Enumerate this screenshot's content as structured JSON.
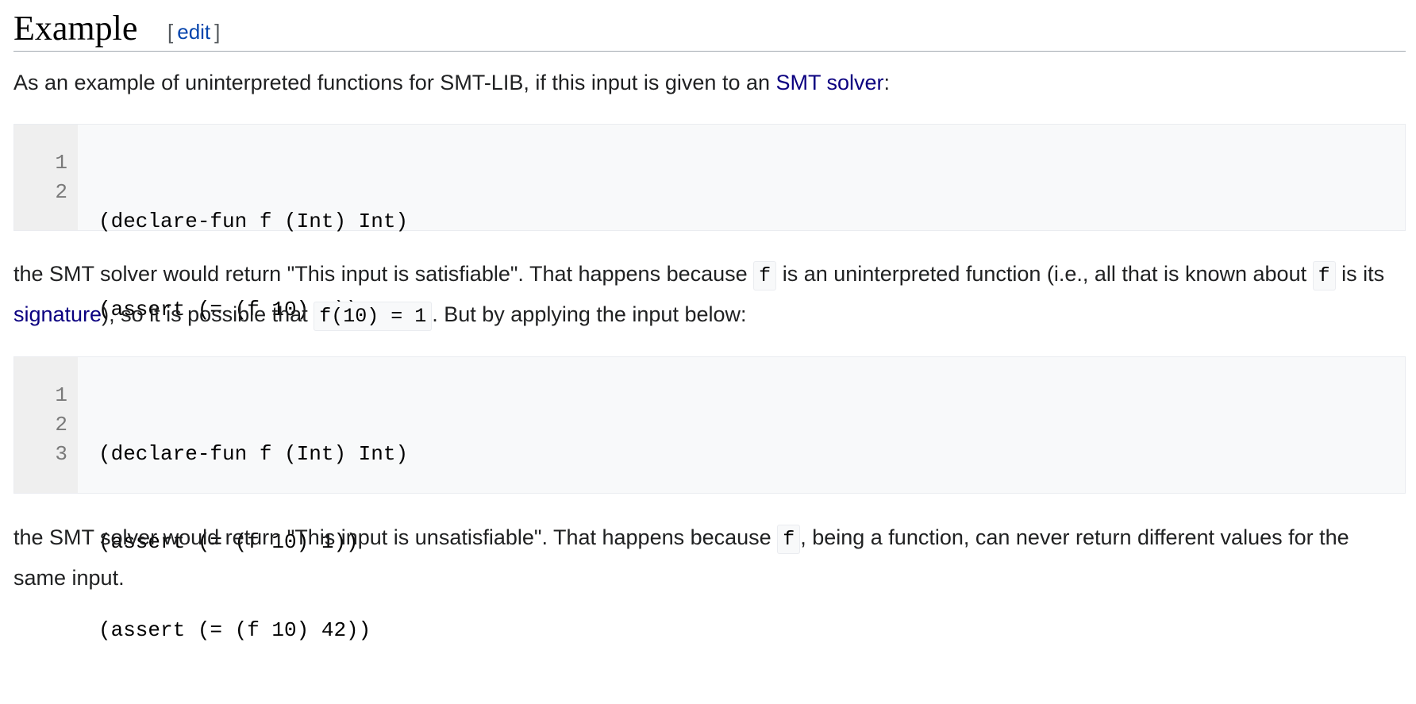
{
  "section": {
    "title": "Example",
    "edit_open": "[",
    "edit_label": "edit",
    "edit_close": "]"
  },
  "para1": {
    "text_before": "As an example of uninterpreted functions for SMT-LIB, if this input is given to an ",
    "link": "SMT solver",
    "text_after": ":"
  },
  "code1": {
    "line_numbers": [
      "1",
      "2"
    ],
    "lines": [
      "(declare-fun f (Int) Int)",
      "(assert (= (f 10) 1))"
    ]
  },
  "para2": {
    "t1": "the SMT solver would return \"This input is satisfiable\". That happens because ",
    "c1": "f",
    "t2": " is an uninterpreted function (i.e., all that is known about ",
    "c2": "f",
    "t3": " is its ",
    "link": "signature",
    "t4": "), so it is possible that ",
    "c3": "f(10) = 1",
    "t5": ". But by applying the input below:"
  },
  "code2": {
    "line_numbers": [
      "1",
      "2",
      "3"
    ],
    "lines": [
      "(declare-fun f (Int) Int)",
      "(assert (= (f 10) 1))",
      "(assert (= (f 10) 42))"
    ]
  },
  "para3": {
    "t1": "the SMT solver would return \"This input is unsatisfiable\". That happens because ",
    "c1": "f",
    "t2": ", being a function, can never return different values for the same input."
  },
  "colors": {
    "link": "#0b0080",
    "edit_link": "#0645ad",
    "code_background": "#f8f9fa",
    "gutter_background": "#efefef"
  }
}
